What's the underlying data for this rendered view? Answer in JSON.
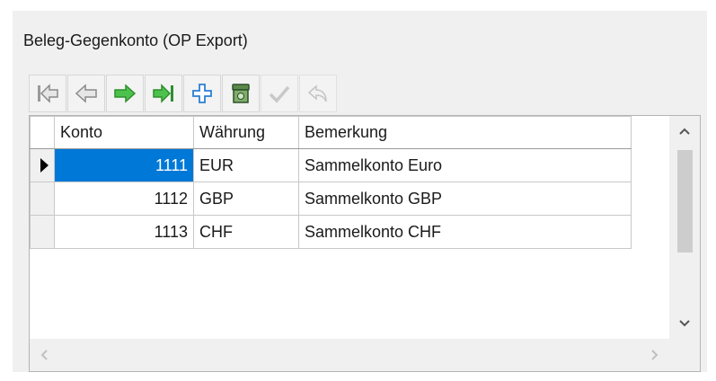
{
  "group_title": "Beleg-Gegenkonto (OP Export)",
  "toolbar": {
    "buttons": [
      {
        "icon": "first-record-icon",
        "enabled": true
      },
      {
        "icon": "previous-record-icon",
        "enabled": true
      },
      {
        "icon": "next-record-icon",
        "enabled": true
      },
      {
        "icon": "last-record-icon",
        "enabled": true
      },
      {
        "icon": "add-record-icon",
        "enabled": true
      },
      {
        "icon": "delete-record-icon",
        "enabled": true
      },
      {
        "icon": "post-record-icon",
        "enabled": false
      },
      {
        "icon": "cancel-record-icon",
        "enabled": false
      }
    ]
  },
  "grid": {
    "columns": [
      "Konto",
      "Währung",
      "Bemerkung"
    ],
    "rows": [
      {
        "konto": "1111",
        "waehrung": "EUR",
        "bemerkung": "Sammelkonto Euro",
        "current": true
      },
      {
        "konto": "1112",
        "waehrung": "GBP",
        "bemerkung": "Sammelkonto GBP",
        "current": false
      },
      {
        "konto": "1113",
        "waehrung": "CHF",
        "bemerkung": "Sammelkonto CHF",
        "current": false
      }
    ]
  },
  "colors": {
    "selection": "#0078d7",
    "nav_green": "#3cb43c",
    "nav_gray": "#a8a8a8",
    "add_blue": "#2a7fd4"
  }
}
